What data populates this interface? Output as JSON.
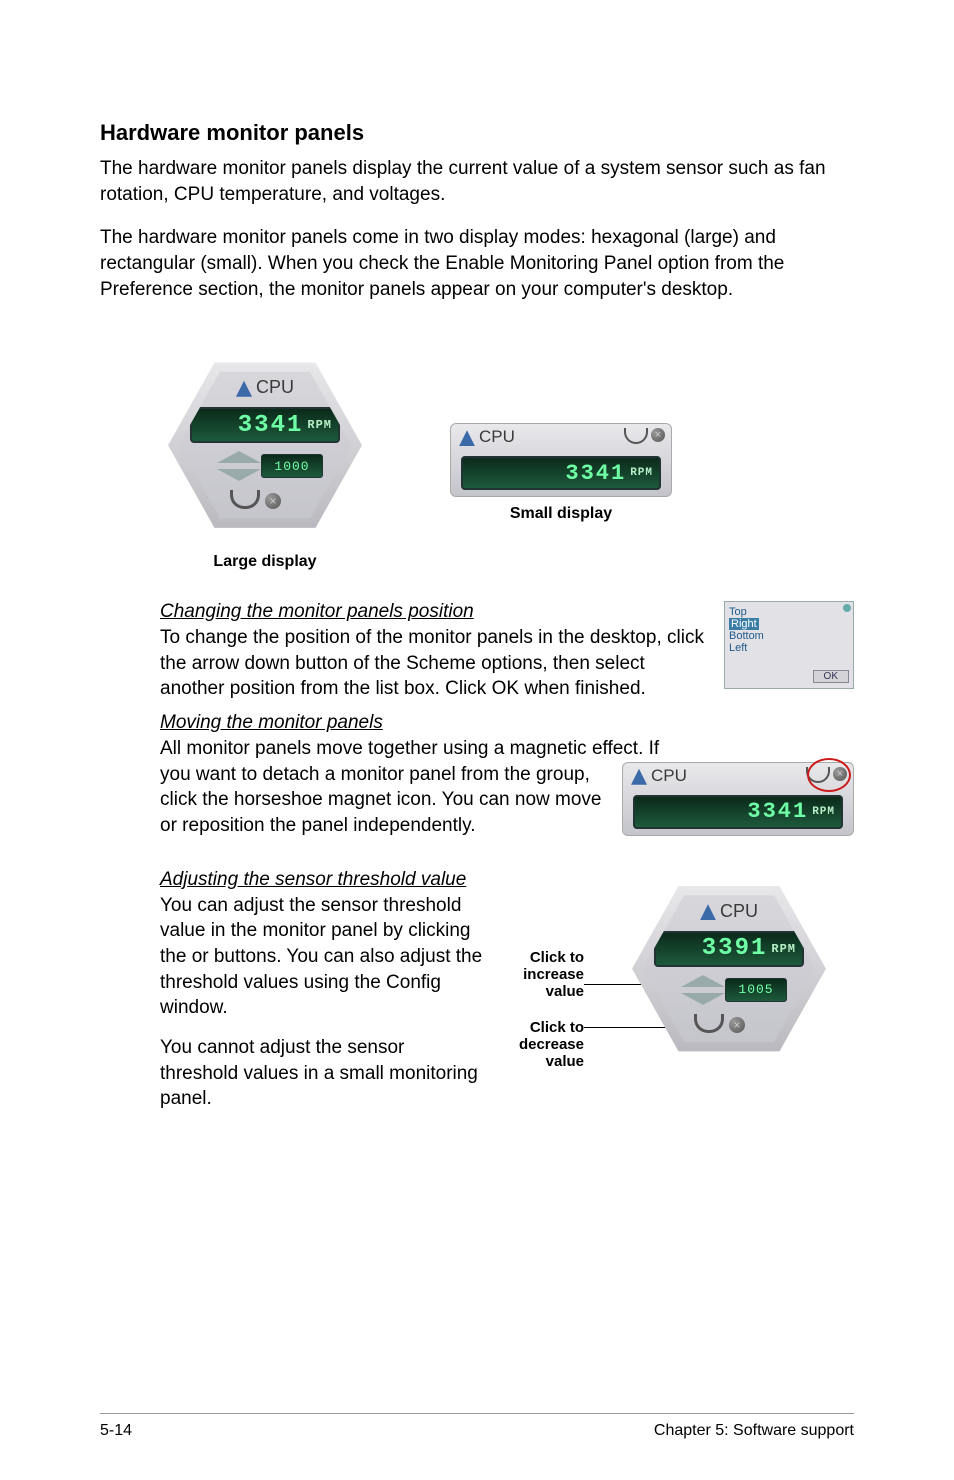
{
  "heading": "Hardware monitor panels",
  "para1": "The hardware monitor panels display the current value of a system sensor such as fan rotation, CPU temperature, and voltages.",
  "para2": "The hardware monitor panels come in two display modes: hexagonal (large) and rectangular (small). When you check the Enable Monitoring Panel option from the Preference section, the monitor panels appear on your computer's desktop.",
  "large": {
    "title": "CPU",
    "value": "3341",
    "unit": "RPM",
    "sub_value": "1000",
    "caption": "Large display"
  },
  "small": {
    "title": "CPU",
    "value": "3341",
    "unit": "RPM",
    "caption": "Small display"
  },
  "sec_changing": {
    "title": "Changing the monitor panels position",
    "body": "To change the position of the monitor panels in the desktop, click the arrow down button of the Scheme options, then select another position from the list box. Click OK when finished."
  },
  "positions": {
    "opt1": "Top",
    "opt2": "Right",
    "opt3": "Bottom",
    "opt4": "Left",
    "ok": "OK"
  },
  "sec_moving": {
    "title": "Moving the monitor panels",
    "line1": "All monitor panels move together using a magnetic effect. If",
    "line2": "you want to detach a monitor panel from the group, click the horseshoe magnet icon. You can now move or reposition the panel independently."
  },
  "moving_panel": {
    "title": "CPU",
    "value": "3341",
    "unit": "RPM"
  },
  "sec_threshold": {
    "title": "Adjusting the sensor threshold value",
    "body1": "You can adjust the sensor threshold value in the monitor panel by clicking the  or  buttons. You can also adjust the threshold values using the Config window.",
    "body2": "You cannot adjust the sensor threshold values in a small monitoring panel."
  },
  "threshold_panel": {
    "title": "CPU",
    "value": "3391",
    "unit": "RPM",
    "sub_value": "1005",
    "label_inc": "Click to increase value",
    "label_dec": "Click to decrease value"
  },
  "footer": {
    "left": "5-14",
    "right": "Chapter 5: Software support"
  }
}
